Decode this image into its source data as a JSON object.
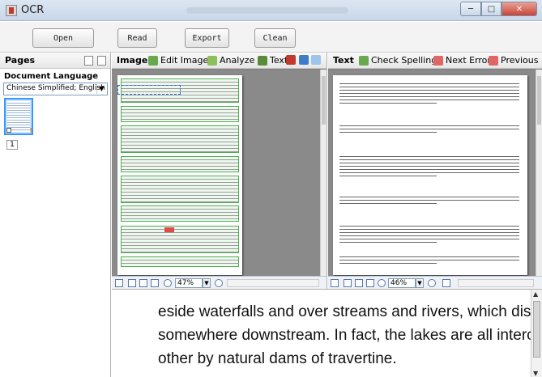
{
  "window": {
    "title": "OCR",
    "min": "─",
    "max": "□",
    "close": "✕"
  },
  "toolbar": {
    "open": "Open",
    "read": "Read",
    "export": "Export",
    "clean": "Clean"
  },
  "pages_panel": {
    "title": "Pages",
    "doc_language_label": "Document Language",
    "language": "Chinese Simplified; English",
    "page_number": "1"
  },
  "image_panel": {
    "title": "Image",
    "edit_image": "Edit Image",
    "analyze": "Analyze",
    "text_tool": "Text",
    "zoom": "47%"
  },
  "text_panel": {
    "title": "Text",
    "check_spelling": "Check Spelling",
    "next_error": "Next Error",
    "previous_error": "Previous Error",
    "pilcrow": "¶",
    "zoom": "46%"
  },
  "zoom_view": {
    "line0": "eside waterfalls and over streams and rivers, which disappea",
    "line1": "somewhere downstream. In fact, the lakes are all interconne",
    "line2": "other by natural dams of travertine."
  }
}
